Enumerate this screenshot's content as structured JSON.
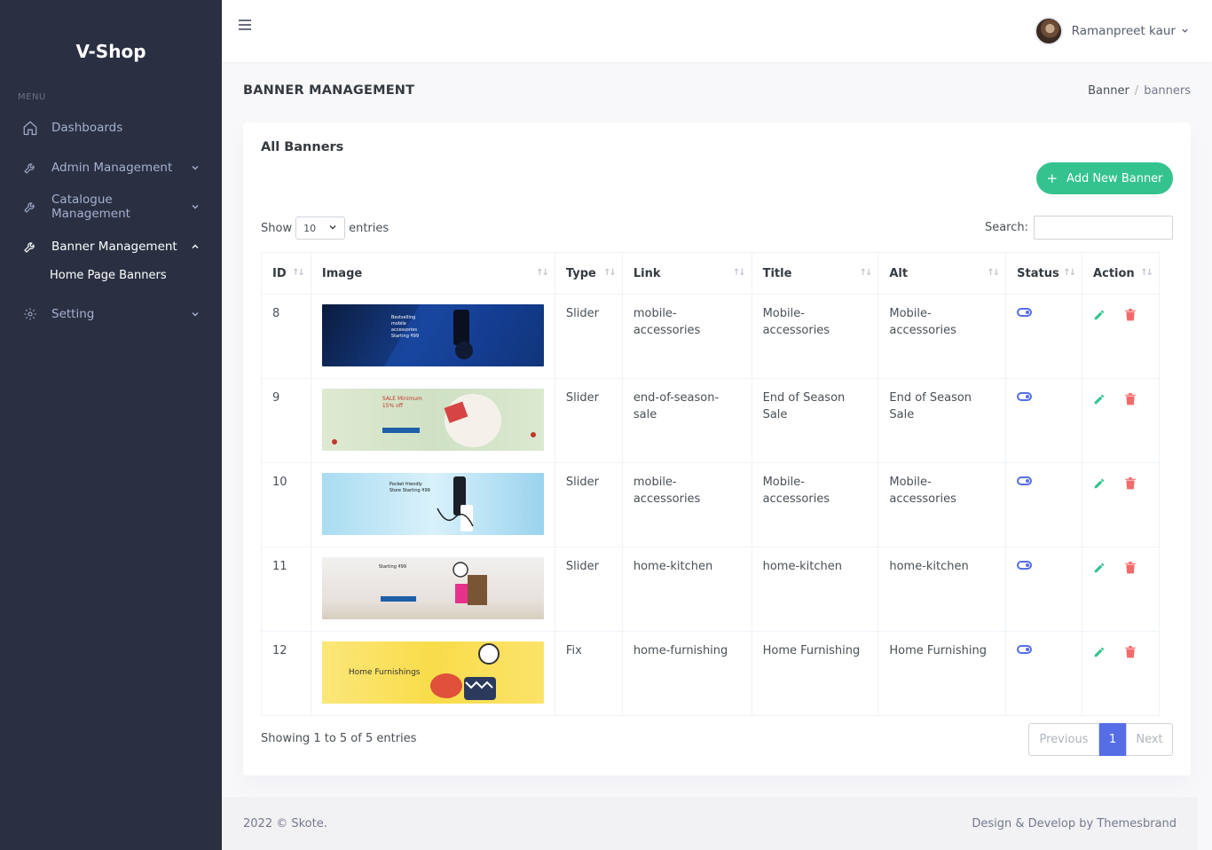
{
  "brand": "V-Shop",
  "menu_title": "MENU",
  "sidebar": {
    "items": [
      {
        "label": "Dashboards",
        "icon": "home-icon"
      },
      {
        "label": "Admin Management",
        "icon": "wrench-icon"
      },
      {
        "label": "Catalogue Management",
        "icon": "wrench-icon"
      },
      {
        "label": "Banner Management",
        "icon": "wrench-icon",
        "active": true
      },
      {
        "label": "Home Page Banners"
      },
      {
        "label": "Setting",
        "icon": "gear-icon"
      }
    ]
  },
  "header": {
    "user_name": "Ramanpreet kaur"
  },
  "page": {
    "title": "BANNER MANAGEMENT",
    "breadcrumb": [
      "Banner",
      "banners"
    ]
  },
  "card": {
    "title": "All Banners",
    "add_button": "Add New Banner",
    "show_label": "Show",
    "entries_label": "entries",
    "page_length": "10",
    "search_label": "Search:"
  },
  "table": {
    "columns": [
      "ID",
      "Image",
      "Type",
      "Link",
      "Title",
      "Alt",
      "Status",
      "Action"
    ],
    "rows": [
      {
        "id": "8",
        "type": "Slider",
        "link": "mobile-accessories",
        "title": "Mobile-accessories",
        "alt": "Mobile-accessories"
      },
      {
        "id": "9",
        "type": "Slider",
        "link": "end-of-season-sale",
        "title": "End of Season Sale",
        "alt": "End of Season Sale"
      },
      {
        "id": "10",
        "type": "Slider",
        "link": "mobile-accessories",
        "title": "Mobile-accessories",
        "alt": "Mobile-accessories"
      },
      {
        "id": "11",
        "type": "Slider",
        "link": "home-kitchen",
        "title": "home-kitchen",
        "alt": "home-kitchen"
      },
      {
        "id": "12",
        "type": "Fix",
        "link": "home-furnishing",
        "title": "Home Furnishing",
        "alt": "Home Furnishing"
      }
    ]
  },
  "banner_text": {
    "b1": "Bestselling mobile accessories Starting ₹99",
    "b2": "SALE Minimum 15% off",
    "b3": "Pocket friendly Store Starting ₹99",
    "b4": "Starting ₹99",
    "b5": "Home Furnishings"
  },
  "info": "Showing 1 to 5 of 5 entries",
  "pager": {
    "previous": "Previous",
    "page": "1",
    "next": "Next"
  },
  "footer": {
    "left": "2022 © Skote.",
    "right": "Design & Develop by Themesbrand"
  },
  "colors": {
    "sidebar": "#2a3042",
    "accent": "#556ee6",
    "success": "#34c38f",
    "danger": "#f46a6a"
  }
}
